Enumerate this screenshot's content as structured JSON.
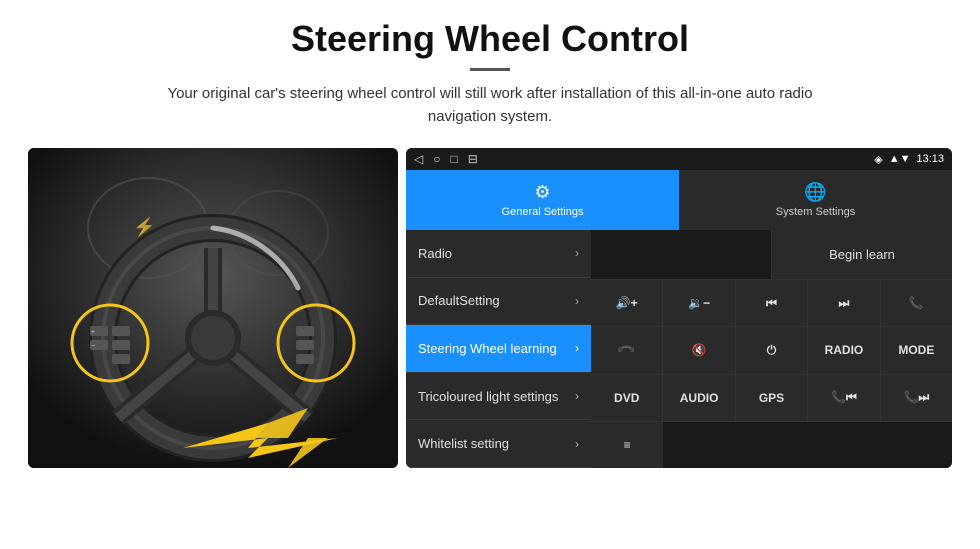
{
  "page": {
    "title": "Steering Wheel Control",
    "subtitle": "Your original car's steering wheel control will still work after installation of this all-in-one auto radio navigation system."
  },
  "status_bar": {
    "nav_back": "◁",
    "nav_home": "○",
    "nav_recent": "□",
    "nav_menu": "⊟",
    "signal": "▾",
    "wifi": "▾",
    "time": "13:13",
    "location": "◈"
  },
  "tabs": [
    {
      "id": "general",
      "label": "General Settings",
      "icon": "⚙",
      "active": true
    },
    {
      "id": "system",
      "label": "System Settings",
      "icon": "🌐",
      "active": false
    }
  ],
  "menu_items": [
    {
      "id": "radio",
      "label": "Radio",
      "active": false
    },
    {
      "id": "default-setting",
      "label": "DefaultSetting",
      "active": false
    },
    {
      "id": "steering-wheel",
      "label": "Steering Wheel learning",
      "active": true
    },
    {
      "id": "tricoloured",
      "label": "Tricoloured light settings",
      "active": false
    },
    {
      "id": "whitelist",
      "label": "Whitelist setting",
      "active": false
    }
  ],
  "controls": {
    "begin_learn_label": "Begin learn",
    "row1": [
      {
        "id": "vol-up",
        "label": "🔊+",
        "type": "icon"
      },
      {
        "id": "vol-down",
        "label": "🔉−",
        "type": "icon"
      },
      {
        "id": "prev",
        "label": "⏮",
        "type": "icon"
      },
      {
        "id": "next",
        "label": "⏭",
        "type": "icon"
      },
      {
        "id": "phone",
        "label": "📞",
        "type": "icon"
      }
    ],
    "row2": [
      {
        "id": "hang-up",
        "label": "↩",
        "type": "icon"
      },
      {
        "id": "mute",
        "label": "🔇",
        "type": "icon"
      },
      {
        "id": "power",
        "label": "⏻",
        "type": "icon"
      },
      {
        "id": "radio-btn",
        "label": "RADIO",
        "type": "text"
      },
      {
        "id": "mode-btn",
        "label": "MODE",
        "type": "text"
      }
    ],
    "row3": [
      {
        "id": "dvd-btn",
        "label": "DVD",
        "type": "text"
      },
      {
        "id": "audio-btn",
        "label": "AUDIO",
        "type": "text"
      },
      {
        "id": "gps-btn",
        "label": "GPS",
        "type": "text"
      },
      {
        "id": "phone-prev",
        "label": "📞⏮",
        "type": "icon"
      },
      {
        "id": "phone-next",
        "label": "📞⏭",
        "type": "icon"
      }
    ],
    "row4": [
      {
        "id": "list-btn",
        "label": "≡",
        "type": "icon"
      }
    ]
  }
}
